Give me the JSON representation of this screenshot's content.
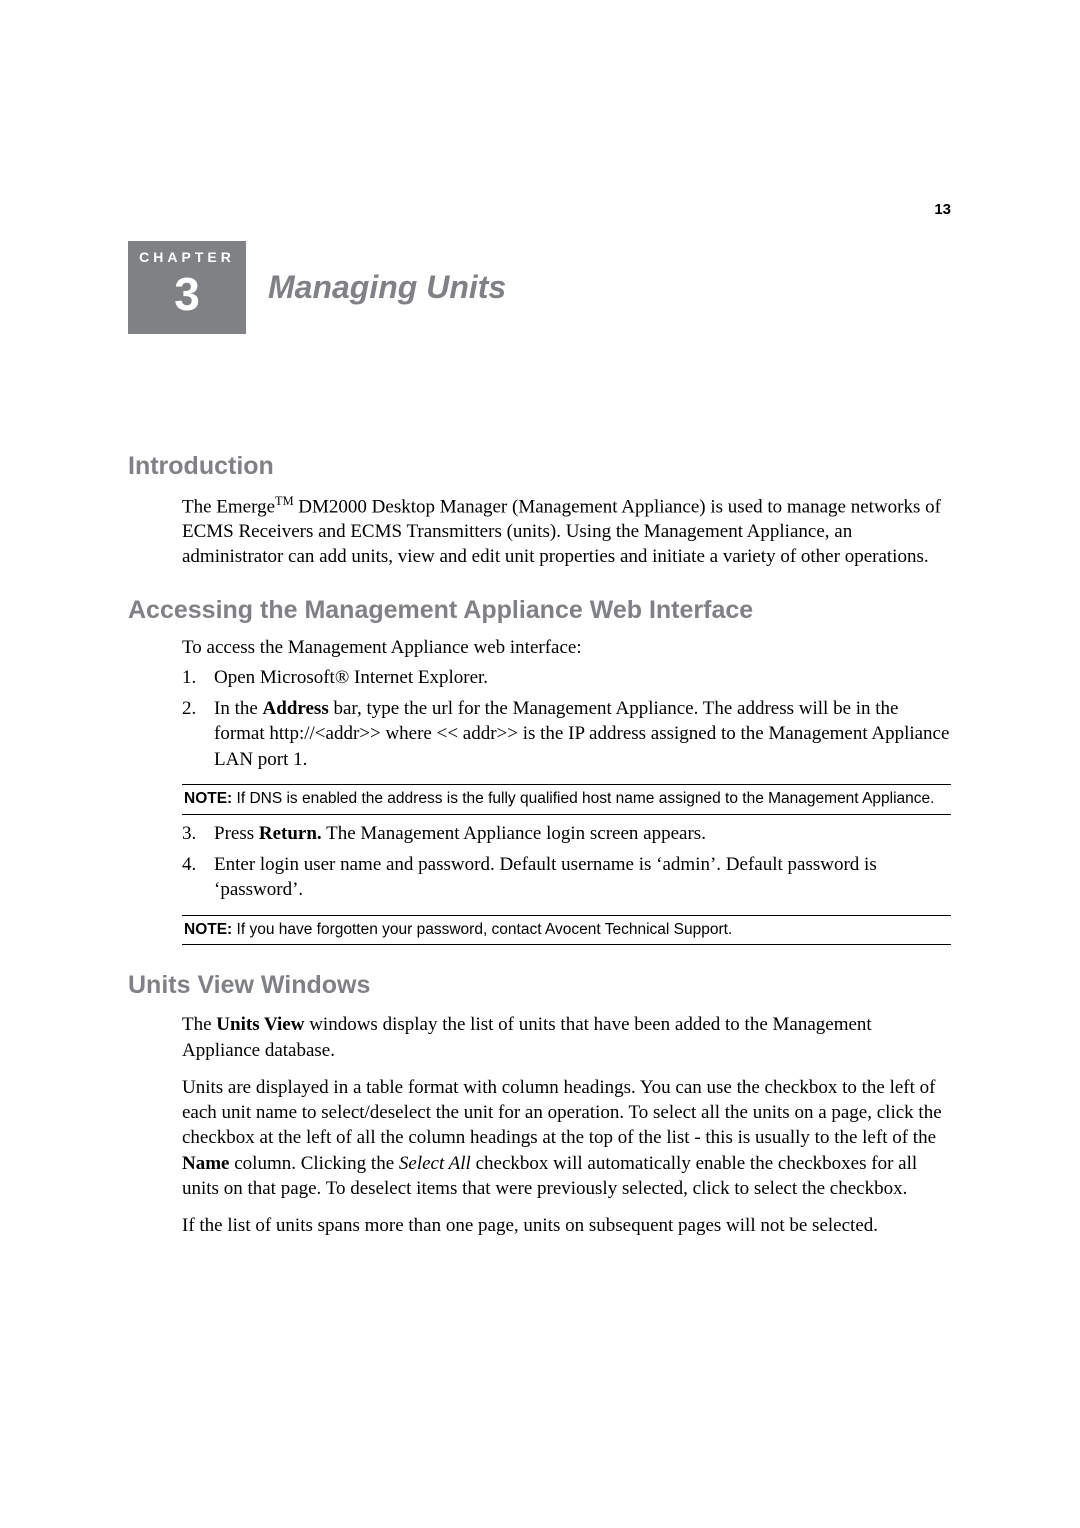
{
  "pageNumber": "13",
  "chapter": {
    "label": "CHAPTER",
    "number": "3",
    "title": "Managing Units"
  },
  "sections": {
    "intro": {
      "heading": "Introduction",
      "para": {
        "pre": "The Emerge",
        "tm": "TM",
        "post1": " DM2000 Desktop Manager (Management Appliance) is used to manage networks of ECMS Receivers and ECMS Transmitters (units). Using the Management Appliance, an administrator can add units, view and edit unit properties and initiate a variety of other operations."
      }
    },
    "access": {
      "heading": "Accessing the Management Appliance Web Interface",
      "lead": "To access the Management Appliance web interface:",
      "steps": {
        "s1": "Open Microsoft® Internet Explorer.",
        "s2_pre": "In the ",
        "s2_bold": "Address",
        "s2_post": " bar, type the url for the Management Appliance. The address will be in the format http://<addr>> where << addr>> is the IP address assigned to the Management Appliance LAN port 1.",
        "s3_pre": "Press ",
        "s3_bold": "Return.",
        "s3_post": " The Management Appliance login screen appears.",
        "s4": "Enter login user name and password. Default username is ‘admin’. Default password is ‘password’."
      },
      "note1_label": "NOTE:",
      "note1": " If DNS is enabled the address is the fully qualified host name assigned to the Management Appliance.",
      "note2_label": "NOTE:",
      "note2": " If you have forgotten your password, contact Avocent Technical Support."
    },
    "units": {
      "heading": "Units View Windows",
      "p1_pre": "The ",
      "p1_bold": "Units View",
      "p1_post": " windows display the list of units that have been added to the Management Appliance database.",
      "p2_pre": "Units are displayed in a table format with column headings. You can use the checkbox to the left of each unit name to select/deselect the unit for an operation. To select all the units on a page, click the checkbox at the left of all the column headings at the top of the list - this is usually to the left of the ",
      "p2_bold": "Name",
      "p2_mid": " column. Clicking the ",
      "p2_ital": "Select All",
      "p2_post": " checkbox will automatically enable the checkboxes for all units on that page. To deselect items that were previously selected, click to select the checkbox.",
      "p3": "If the list of units spans more than one page, units on subsequent pages will not be selected."
    }
  }
}
